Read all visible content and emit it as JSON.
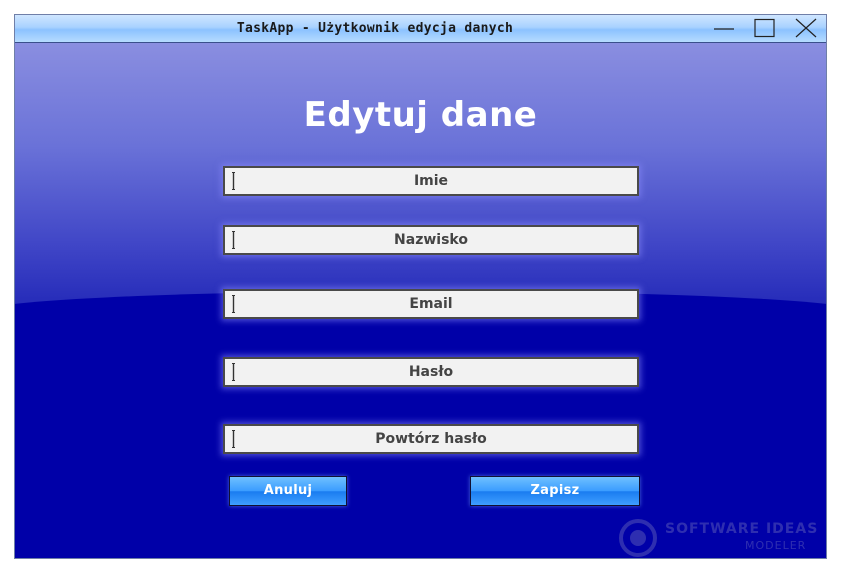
{
  "window": {
    "title": "TaskApp - Użytkownik edycja danych"
  },
  "form": {
    "heading": "Edytuj dane",
    "fields": [
      {
        "label": "Imie"
      },
      {
        "label": "Nazwisko"
      },
      {
        "label": "Email"
      },
      {
        "label": "Hasło"
      },
      {
        "label": "Powtórz hasło"
      }
    ],
    "cancel_label": "Anuluj",
    "save_label": "Zapisz"
  },
  "watermark": {
    "line1": "SOFTWARE IDEAS",
    "line2": "MODELER"
  },
  "colors": {
    "background": "#0000a8",
    "field_background": "#f2f2f2",
    "button": "#3a9cff",
    "titlebar": "#a9d2ff"
  }
}
